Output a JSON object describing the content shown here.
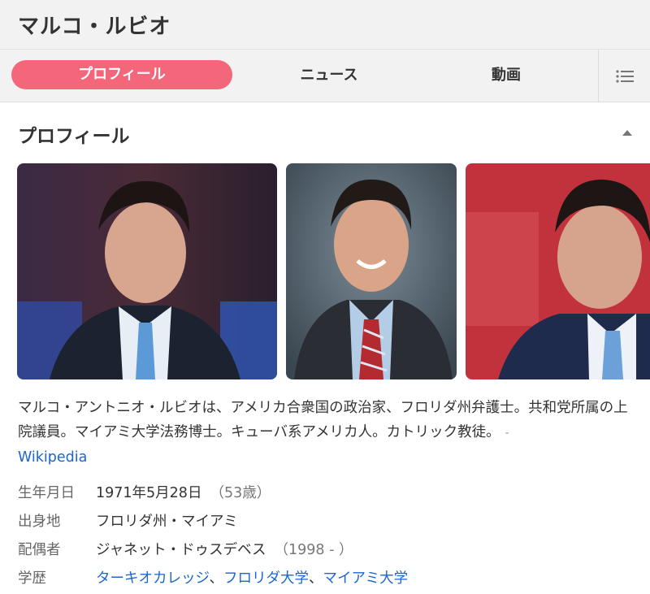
{
  "header": {
    "title": "マルコ・ルビオ"
  },
  "tabs": [
    {
      "label": "プロフィール",
      "active": true
    },
    {
      "label": "ニュース"
    },
    {
      "label": "動画"
    }
  ],
  "profile": {
    "section_title": "プロフィール",
    "summary_text": "マルコ・アントニオ・ルビオは、アメリカ合衆国の政治家、フロリダ州弁護士。共和党所属の上院議員。マイアミ大学法務博士。キューバ系アメリカ人。カトリック教徒。",
    "summary_dash": "-",
    "source_link": "Wikipedia",
    "facts": {
      "birth": {
        "label": "生年月日",
        "value": "1971年5月28日",
        "extra": "（53歳）"
      },
      "birthplace": {
        "label": "出身地",
        "value": "フロリダ州・マイアミ"
      },
      "spouse": {
        "label": "配偶者",
        "value": "ジャネット・ドゥスデベス",
        "extra": "（1998 - ）"
      },
      "education": {
        "label": "学歴",
        "items": [
          "ターキオカレッジ",
          "フロリダ大学",
          "マイアミ大学"
        ],
        "separator": "、"
      }
    }
  },
  "colors": {
    "accent": "#f4667a",
    "link": "#1a66d2",
    "header_bg": "#f2f2f2"
  },
  "icons": {
    "menu": "list-icon",
    "collapse": "caret-up-icon"
  }
}
